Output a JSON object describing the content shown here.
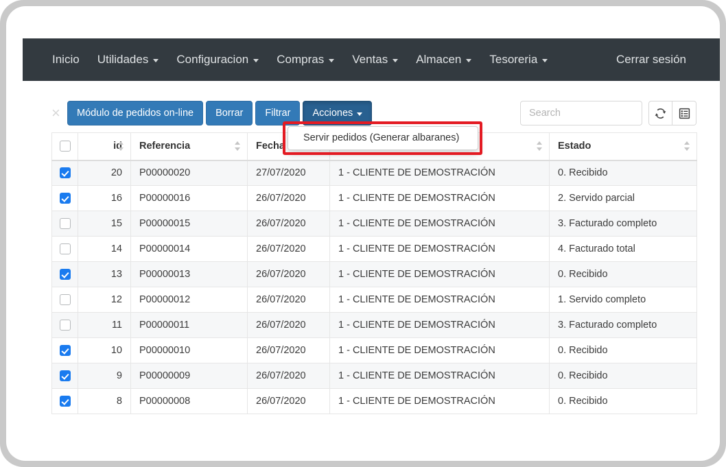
{
  "navbar": {
    "items": [
      {
        "label": "Inicio",
        "has_caret": false
      },
      {
        "label": "Utilidades",
        "has_caret": true
      },
      {
        "label": "Configuracion",
        "has_caret": true
      },
      {
        "label": "Compras",
        "has_caret": true
      },
      {
        "label": "Ventas",
        "has_caret": true
      },
      {
        "label": "Almacen",
        "has_caret": true
      },
      {
        "label": "Tesoreria",
        "has_caret": true
      }
    ],
    "logout_label": "Cerrar sesión"
  },
  "toolbar": {
    "close_label": "×",
    "buttons": [
      {
        "label": "Módulo de pedidos on-line",
        "active": false,
        "caret": false
      },
      {
        "label": "Borrar",
        "active": false,
        "caret": false
      },
      {
        "label": "Filtrar",
        "active": false,
        "caret": false
      },
      {
        "label": "Acciones",
        "active": true,
        "caret": true
      }
    ],
    "search_placeholder": "Search",
    "search_value": "",
    "refresh_icon": "refresh-icon",
    "columns_icon": "column-chooser-icon"
  },
  "dropdown": {
    "open": true,
    "items": [
      {
        "label": "Servir pedidos (Generar albaranes)"
      }
    ]
  },
  "highlight": {
    "color": "#e31b23"
  },
  "table": {
    "columns": [
      {
        "key": "checkbox",
        "label": "",
        "sortable": false
      },
      {
        "key": "id",
        "label": "id",
        "sortable": true,
        "align": "right"
      },
      {
        "key": "referencia",
        "label": "Referencia",
        "sortable": true,
        "align": "left"
      },
      {
        "key": "fecha",
        "label": "Fecha",
        "sortable": true,
        "align": "left"
      },
      {
        "key": "cliente",
        "label": "",
        "sortable": true,
        "align": "left"
      },
      {
        "key": "estado",
        "label": "Estado",
        "sortable": true,
        "align": "left"
      }
    ],
    "header_select_all_checked": false,
    "rows": [
      {
        "checked": true,
        "id": "20",
        "referencia": "P00000020",
        "fecha": "27/07/2020",
        "cliente": "1 - CLIENTE DE DEMOSTRACIÓN",
        "estado": "0. Recibido"
      },
      {
        "checked": true,
        "id": "16",
        "referencia": "P00000016",
        "fecha": "26/07/2020",
        "cliente": "1 - CLIENTE DE DEMOSTRACIÓN",
        "estado": "2. Servido parcial"
      },
      {
        "checked": false,
        "id": "15",
        "referencia": "P00000015",
        "fecha": "26/07/2020",
        "cliente": "1 - CLIENTE DE DEMOSTRACIÓN",
        "estado": "3. Facturado completo"
      },
      {
        "checked": false,
        "id": "14",
        "referencia": "P00000014",
        "fecha": "26/07/2020",
        "cliente": "1 - CLIENTE DE DEMOSTRACIÓN",
        "estado": "4. Facturado total"
      },
      {
        "checked": true,
        "id": "13",
        "referencia": "P00000013",
        "fecha": "26/07/2020",
        "cliente": "1 - CLIENTE DE DEMOSTRACIÓN",
        "estado": "0. Recibido"
      },
      {
        "checked": false,
        "id": "12",
        "referencia": "P00000012",
        "fecha": "26/07/2020",
        "cliente": "1 - CLIENTE DE DEMOSTRACIÓN",
        "estado": "1. Servido completo"
      },
      {
        "checked": false,
        "id": "11",
        "referencia": "P00000011",
        "fecha": "26/07/2020",
        "cliente": "1 - CLIENTE DE DEMOSTRACIÓN",
        "estado": "3. Facturado completo"
      },
      {
        "checked": true,
        "id": "10",
        "referencia": "P00000010",
        "fecha": "26/07/2020",
        "cliente": "1 - CLIENTE DE DEMOSTRACIÓN",
        "estado": "0. Recibido"
      },
      {
        "checked": true,
        "id": "9",
        "referencia": "P00000009",
        "fecha": "26/07/2020",
        "cliente": "1 - CLIENTE DE DEMOSTRACIÓN",
        "estado": "0. Recibido"
      },
      {
        "checked": true,
        "id": "8",
        "referencia": "P00000008",
        "fecha": "26/07/2020",
        "cliente": "1 - CLIENTE DE DEMOSTRACIÓN",
        "estado": "0. Recibido"
      }
    ]
  },
  "colors": {
    "navbar_bg": "#333a40",
    "primary_button": "#337ab7",
    "active_button": "#286090",
    "checkbox_checked": "#1a7bef",
    "highlight_red": "#e31b23"
  }
}
